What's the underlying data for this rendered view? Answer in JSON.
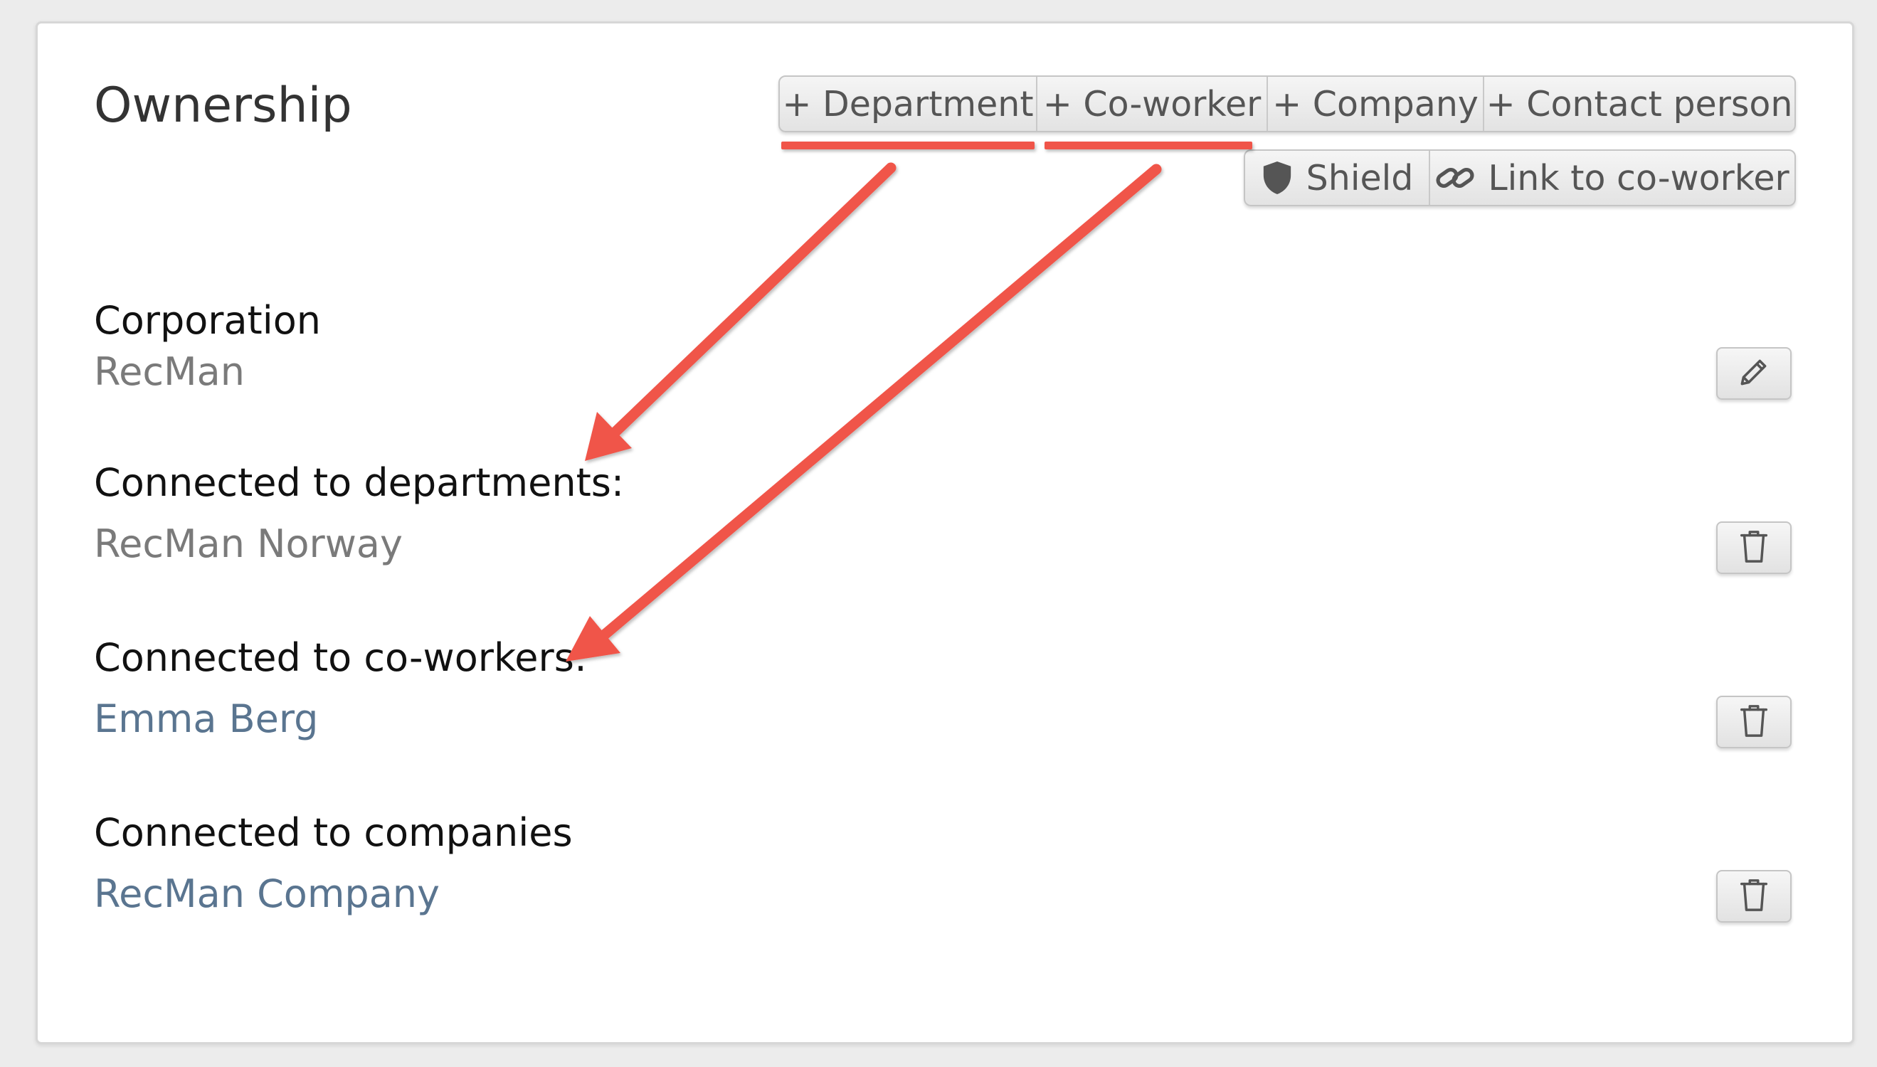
{
  "panel": {
    "title": "Ownership"
  },
  "toolbar": {
    "add_buttons": [
      {
        "label": "+ Department"
      },
      {
        "label": "+ Co-worker"
      },
      {
        "label": "+ Company"
      },
      {
        "label": "+ Contact person"
      }
    ],
    "action_buttons": [
      {
        "label": "Shield",
        "icon": "shield-icon"
      },
      {
        "label": "Link to co-worker",
        "icon": "link-icon"
      }
    ]
  },
  "sections": {
    "corporation": {
      "label": "Corporation",
      "value": "RecMan",
      "action_icon": "pencil-icon"
    },
    "departments": {
      "label": "Connected to departments:",
      "value": "RecMan Norway",
      "action_icon": "trash-icon"
    },
    "coworkers": {
      "label": "Connected to co-workers:",
      "value": "Emma Berg",
      "action_icon": "trash-icon"
    },
    "companies": {
      "label": "Connected to companies",
      "value": "RecMan Company",
      "action_icon": "trash-icon"
    }
  },
  "colors": {
    "annotation": "#f0554a",
    "link_text": "#5a7590",
    "muted_text": "#7a7a7a"
  }
}
